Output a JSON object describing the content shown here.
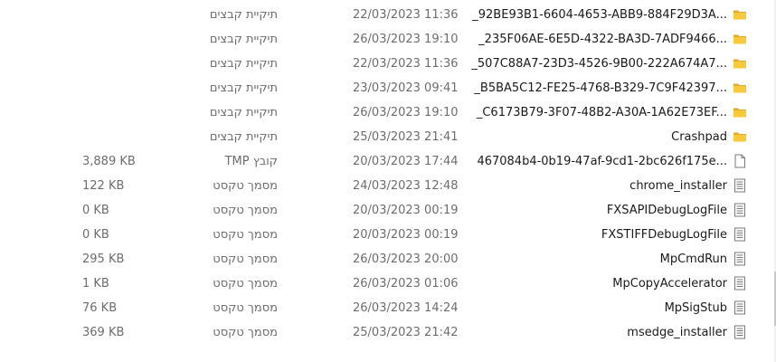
{
  "files": [
    {
      "name": "_92BE93B1-6604-4653-ABB9-884F29D3A...",
      "date": "22/03/2023 11:36",
      "type": "תיקיית קבצים",
      "size": "",
      "icon": "folder-icon"
    },
    {
      "name": "_235F06AE-6E5D-4322-BA3D-7ADF9466...",
      "date": "26/03/2023 19:10",
      "type": "תיקיית קבצים",
      "size": "",
      "icon": "folder-icon"
    },
    {
      "name": "_507C88A7-23D3-4526-9B00-222A674A7...",
      "date": "22/03/2023 11:36",
      "type": "תיקיית קבצים",
      "size": "",
      "icon": "folder-icon"
    },
    {
      "name": "_B5BA5C12-FE25-4768-B329-7C9F42397...",
      "date": "23/03/2023 09:41",
      "type": "תיקיית קבצים",
      "size": "",
      "icon": "folder-icon"
    },
    {
      "name": "_C6173B79-3F07-48B2-A30A-1A62E73EF...",
      "date": "26/03/2023 19:10",
      "type": "תיקיית קבצים",
      "size": "",
      "icon": "folder-icon"
    },
    {
      "name": "Crashpad",
      "date": "25/03/2023 21:41",
      "type": "תיקיית קבצים",
      "size": "",
      "icon": "folder-icon"
    },
    {
      "name": "467084b4-0b19-47af-9cd1-2bc626f175e...",
      "date": "20/03/2023 17:44",
      "type": "קובץ TMP",
      "size": "3,889 KB",
      "icon": "blank-file-icon"
    },
    {
      "name": "chrome_installer",
      "date": "24/03/2023 12:48",
      "type": "מסמך טקסט",
      "size": "122 KB",
      "icon": "text-file-icon"
    },
    {
      "name": "FXSAPIDebugLogFile",
      "date": "20/03/2023 00:19",
      "type": "מסמך טקסט",
      "size": "0 KB",
      "icon": "text-file-icon"
    },
    {
      "name": "FXSTIFFDebugLogFile",
      "date": "20/03/2023 00:19",
      "type": "מסמך טקסט",
      "size": "0 KB",
      "icon": "text-file-icon"
    },
    {
      "name": "MpCmdRun",
      "date": "26/03/2023 20:00",
      "type": "מסמך טקסט",
      "size": "295 KB",
      "icon": "text-file-icon"
    },
    {
      "name": "MpCopyAccelerator",
      "date": "26/03/2023 01:06",
      "type": "מסמך טקסט",
      "size": "1 KB",
      "icon": "text-file-icon"
    },
    {
      "name": "MpSigStub",
      "date": "26/03/2023 14:24",
      "type": "מסמך טקסט",
      "size": "76 KB",
      "icon": "text-file-icon"
    },
    {
      "name": "msedge_installer",
      "date": "25/03/2023 21:42",
      "type": "מסמך טקסט",
      "size": "369 KB",
      "icon": "text-file-icon"
    }
  ],
  "colors": {
    "folder": "#f8c93b",
    "folder_dark": "#e4a92a",
    "file_border": "#7a7a7a",
    "muted_text": "#6d6d6d"
  }
}
